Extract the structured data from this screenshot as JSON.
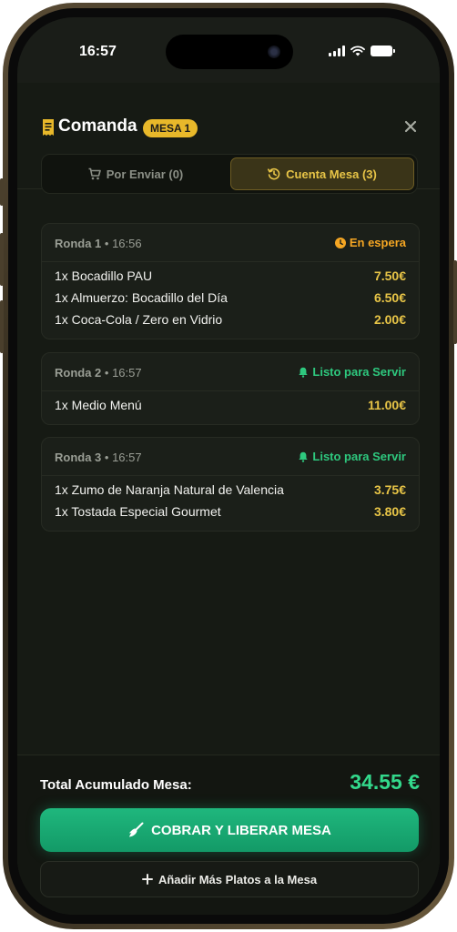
{
  "status_bar": {
    "time": "16:57"
  },
  "header": {
    "title": "Comanda",
    "badge": "MESA 1",
    "close_icon": "close-icon",
    "receipt_icon": "receipt-icon"
  },
  "tabs": [
    {
      "label": "Por Enviar (0)",
      "icon": "cart-icon",
      "active": false
    },
    {
      "label": "Cuenta Mesa (3)",
      "icon": "history-icon",
      "active": true
    }
  ],
  "rondas": [
    {
      "name": "Ronda 1",
      "time": "16:56",
      "status": "En espera",
      "status_icon": "clock-icon",
      "status_color": "#f5a623",
      "items": [
        {
          "name": "1x Bocadillo PAU",
          "price": "7.50€"
        },
        {
          "name": "1x Almuerzo: Bocadillo del Día",
          "price": "6.50€"
        },
        {
          "name": "1x Coca-Cola / Zero en Vidrio",
          "price": "2.00€"
        }
      ]
    },
    {
      "name": "Ronda 2",
      "time": "16:57",
      "status": "Listo para Servir",
      "status_icon": "bell-icon",
      "status_color": "#2ec87e",
      "items": [
        {
          "name": "1x Medio Menú",
          "price": "11.00€"
        }
      ]
    },
    {
      "name": "Ronda 3",
      "time": "16:57",
      "status": "Listo para Servir",
      "status_icon": "bell-icon",
      "status_color": "#2ec87e",
      "items": [
        {
          "name": "1x Zumo de Naranja Natural de Valencia",
          "price": "3.75€"
        },
        {
          "name": "1x Tostada Especial Gourmet",
          "price": "3.80€"
        }
      ]
    }
  ],
  "footer": {
    "total_label": "Total Acumulado Mesa:",
    "total_value": "34.55 €",
    "cobrar_label": "COBRAR Y LIBERAR MESA",
    "cobrar_icon": "broom-icon",
    "add_label": "Añadir Más Platos a la Mesa",
    "add_icon": "plus-icon"
  },
  "colors": {
    "accent_gold": "#e8c547",
    "accent_green": "#33d98c",
    "background": "#161a14"
  }
}
